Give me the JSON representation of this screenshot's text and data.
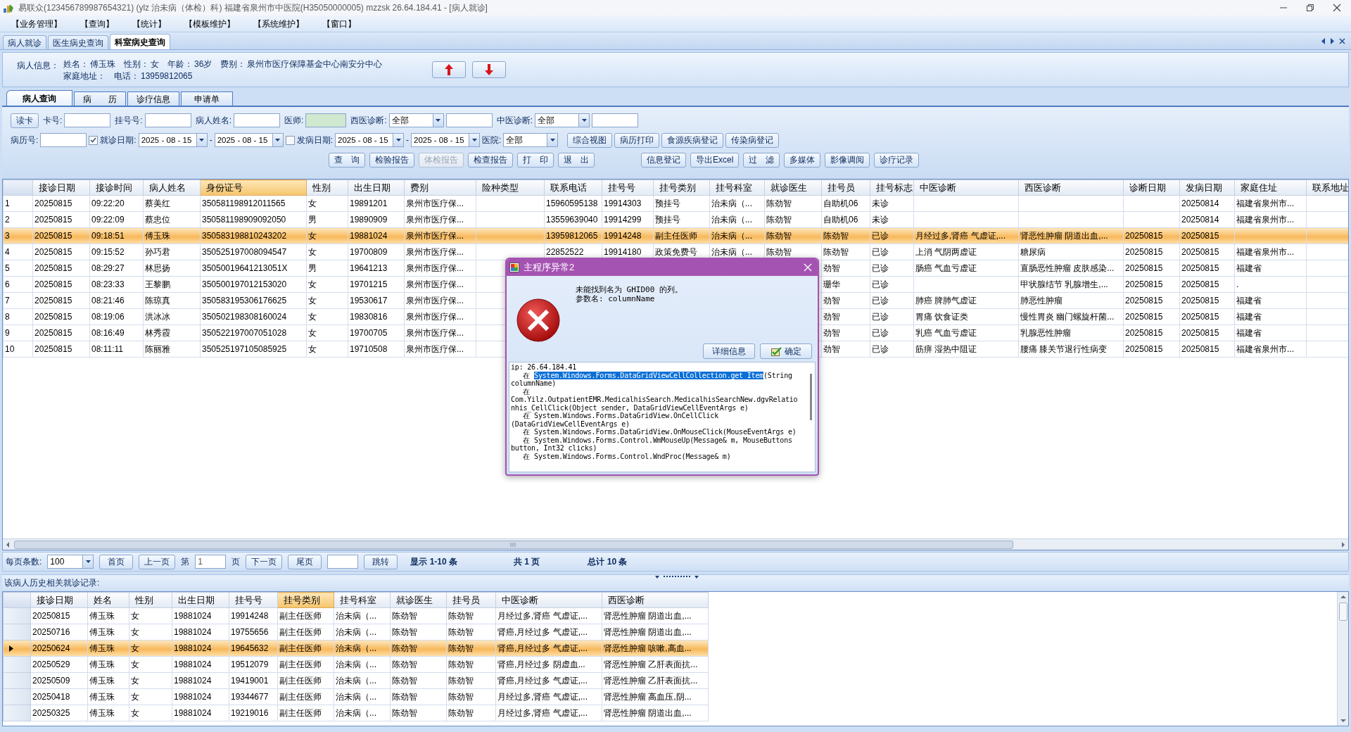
{
  "window": {
    "title": "易联众(123456789987654321) (ylz 治未病（体检）科) 福建省泉州市中医院(H35050000005) mzzsk 26.64.184.41 - [病人就诊]"
  },
  "menu": [
    "【业务管理】",
    "【查询】",
    "【统计】",
    "【模板维护】",
    "【系统维护】",
    "【窗口】"
  ],
  "doc_tabs": [
    {
      "label": "病人就诊",
      "selected": false
    },
    {
      "label": "医生病史查询",
      "selected": false
    },
    {
      "label": "科室病史查询",
      "selected": true
    }
  ],
  "patient_info": {
    "title": "病人信息：",
    "lines": [
      [
        {
          "label": "姓名：",
          "value": "傅玉珠"
        },
        {
          "label": "性别：",
          "value": "女"
        },
        {
          "label": "年龄：",
          "value": "36岁"
        },
        {
          "label": "费别：",
          "value": "泉州市医疗保障基金中心南安分中心"
        }
      ],
      [
        {
          "label": "家庭地址："
        },
        {
          "label": "电话：",
          "value": "13959812065"
        }
      ]
    ]
  },
  "sub_tabs": [
    {
      "label": "病人查询",
      "selected": true
    },
    {
      "label": "病　　历",
      "selected": false
    },
    {
      "label": "诊疗信息",
      "selected": false
    },
    {
      "label": "申请单",
      "selected": false
    }
  ],
  "filter": {
    "row_1": [
      {
        "kind": "button",
        "label": "读卡"
      },
      {
        "kind": "label",
        "text": "卡号:"
      },
      {
        "kind": "field",
        "required": false
      },
      {
        "kind": "label",
        "text": "挂号号:"
      },
      {
        "kind": "field",
        "required": false
      },
      {
        "kind": "label",
        "text": "病人姓名:"
      },
      {
        "kind": "field",
        "required": false
      },
      {
        "kind": "label",
        "text": "医师:"
      },
      {
        "kind": "field",
        "required": true
      },
      {
        "kind": "label",
        "text": "西医诊断:"
      },
      {
        "kind": "combo",
        "value": "全部"
      },
      {
        "kind": "field",
        "required": false
      },
      {
        "kind": "label",
        "text": "中医诊断:"
      },
      {
        "kind": "combo",
        "value": "全部"
      },
      {
        "kind": "field",
        "required": false
      }
    ],
    "row_2": [
      {
        "kind": "label",
        "text": "病历号:"
      },
      {
        "kind": "field",
        "required": false
      },
      {
        "kind": "checkbox",
        "checked": true
      },
      {
        "kind": "label",
        "text": "就诊日期:"
      },
      {
        "kind": "date",
        "value": "2025 - 08 - 15"
      },
      {
        "kind": "label",
        "text": "-"
      },
      {
        "kind": "date",
        "value": "2025 - 08 - 15"
      },
      {
        "kind": "checkbox",
        "checked": false
      },
      {
        "kind": "label",
        "text": "发病日期:"
      },
      {
        "kind": "date",
        "value": "2025 - 08 - 15"
      },
      {
        "kind": "label",
        "text": "-"
      },
      {
        "kind": "date",
        "value": "2025 - 08 - 15"
      },
      {
        "kind": "label",
        "text": "医院:"
      },
      {
        "kind": "combo",
        "value": "全部"
      },
      {
        "kind": "button",
        "label": "综合视图"
      },
      {
        "kind": "button",
        "label": "病历打印"
      },
      {
        "kind": "button",
        "label": "食源疾病登记"
      },
      {
        "kind": "button",
        "label": "传染病登记"
      }
    ],
    "row_3": {
      "left_buttons": [
        {
          "label": "查　询",
          "disabled": false
        },
        {
          "label": "检验报告",
          "disabled": false
        },
        {
          "label": "体检报告",
          "disabled": true
        },
        {
          "label": "检查报告",
          "disabled": false
        },
        {
          "label": "打　印",
          "disabled": false
        },
        {
          "label": "退　出",
          "disabled": false
        }
      ],
      "right_buttons": [
        {
          "label": "信息登记",
          "disabled": false
        },
        {
          "label": "导出Excel",
          "disabled": false
        },
        {
          "label": "过　滤",
          "disabled": false
        },
        {
          "label": "多媒体",
          "disabled": false
        },
        {
          "label": "影像调阅",
          "disabled": false
        },
        {
          "label": "诊疗记录",
          "disabled": false
        }
      ]
    }
  },
  "main_grid": {
    "columns": [
      {
        "label": "接诊日期",
        "selected": false
      },
      {
        "label": "接诊时间",
        "selected": false
      },
      {
        "label": "病人姓名",
        "selected": false
      },
      {
        "label": "身份证号",
        "selected": true
      },
      {
        "label": "性别",
        "selected": false
      },
      {
        "label": "出生日期",
        "selected": false
      },
      {
        "label": "费别",
        "selected": false
      },
      {
        "label": "险种类型",
        "selected": false
      },
      {
        "label": "联系电话",
        "selected": false
      },
      {
        "label": "挂号号",
        "selected": false
      },
      {
        "label": "挂号类别",
        "selected": false
      },
      {
        "label": "挂号科室",
        "selected": false
      },
      {
        "label": "就诊医生",
        "selected": false
      },
      {
        "label": "挂号员",
        "selected": false
      },
      {
        "label": "挂号标志",
        "selected": false
      },
      {
        "label": "中医诊断",
        "selected": false
      },
      {
        "label": "西医诊断",
        "selected": false
      },
      {
        "label": "诊断日期",
        "selected": false
      },
      {
        "label": "发病日期",
        "selected": false
      },
      {
        "label": "家庭住址",
        "selected": false
      },
      {
        "label": "联系地址",
        "selected": false
      }
    ],
    "rows": [
      {
        "number": "1",
        "selected": false,
        "cells": [
          "20250815",
          "09:22:20",
          "蔡美红",
          "350581198912011565",
          "女",
          "19891201",
          "泉州市医疗保...",
          null,
          "15960595138",
          "19914303",
          "预挂号",
          "治未病（...",
          "陈劲智",
          "自助机06",
          "未诊",
          null,
          null,
          null,
          "20250814",
          "福建省泉州市...",
          null
        ]
      },
      {
        "number": "2",
        "selected": false,
        "cells": [
          "20250815",
          "09:22:09",
          "蔡忠位",
          "350581198909092050",
          "男",
          "19890909",
          "泉州市医疗保...",
          null,
          "13559639040",
          "19914299",
          "预挂号",
          "治未病（...",
          "陈劲智",
          "自助机06",
          "未诊",
          null,
          null,
          null,
          "20250814",
          "福建省泉州市...",
          null
        ]
      },
      {
        "number": "3",
        "selected": true,
        "cells": [
          "20250815",
          "09:18:51",
          "傅玉珠",
          "350583198810243202",
          "女",
          "19881024",
          "泉州市医疗保...",
          null,
          "13959812065",
          "19914248",
          "副主任医师",
          "治未病（...",
          "陈劲智",
          "陈劲智",
          "已诊",
          "月经过多,肾癌 气虚证,...",
          "肾恶性肿瘤 阴道出血,...",
          "20250815",
          "20250815",
          null,
          null
        ]
      },
      {
        "number": "4",
        "selected": false,
        "cells": [
          "20250815",
          "09:15:52",
          "孙巧君",
          "350525197008094547",
          "女",
          "19700809",
          "泉州市医疗保...",
          null,
          "22852522",
          "19914180",
          "政策免费号",
          "治未病（...",
          "陈劲智",
          "陈劲智",
          "已诊",
          "上消 气阴两虚证",
          "糖尿病",
          "20250815",
          "20250815",
          "福建省泉州市...",
          null
        ]
      },
      {
        "number": "5",
        "selected": false,
        "cells": [
          "20250815",
          "08:29:27",
          "林思扬",
          "35050019641213051X",
          "男",
          "19641213",
          "泉州市医疗保...",
          null,
          null,
          null,
          null,
          null,
          null,
          "劲智",
          "已诊",
          "肠癌 气血亏虚证",
          "直肠恶性肿瘤 皮肤感染...",
          "20250815",
          "20250815",
          "福建省",
          null
        ]
      },
      {
        "number": "6",
        "selected": false,
        "cells": [
          "20250815",
          "08:23:33",
          "王黎鹏",
          "350500197012153020",
          "女",
          "19701215",
          "泉州市医疗保...",
          null,
          null,
          null,
          null,
          null,
          null,
          "珊华",
          "已诊",
          null,
          "甲状腺结节 乳腺增生,...",
          "20250815",
          "20250815",
          ".",
          null
        ]
      },
      {
        "number": "7",
        "selected": false,
        "cells": [
          "20250815",
          "08:21:46",
          "陈琼真",
          "350583195306176625",
          "女",
          "19530617",
          "泉州市医疗保...",
          null,
          null,
          null,
          null,
          null,
          null,
          "劲智",
          "已诊",
          "肺癌 脾肺气虚证",
          "肺恶性肿瘤",
          "20250815",
          "20250815",
          "福建省",
          null
        ]
      },
      {
        "number": "8",
        "selected": false,
        "cells": [
          "20250815",
          "08:19:06",
          "洪冰冰",
          "350502198308160024",
          "女",
          "19830816",
          "泉州市医疗保...",
          null,
          null,
          null,
          null,
          null,
          null,
          "劲智",
          "已诊",
          "胃痛 饮食证类",
          "慢性胃炎 幽门螺旋杆菌...",
          "20250815",
          "20250815",
          "福建省",
          null
        ]
      },
      {
        "number": "9",
        "selected": false,
        "cells": [
          "20250815",
          "08:16:49",
          "林秀霞",
          "350522197007051028",
          "女",
          "19700705",
          "泉州市医疗保...",
          null,
          null,
          null,
          null,
          null,
          null,
          "劲智",
          "已诊",
          "乳癌 气血亏虚证",
          "乳腺恶性肿瘤",
          "20250815",
          "20250815",
          "福建省",
          null
        ]
      },
      {
        "number": "10",
        "selected": false,
        "cells": [
          "20250815",
          "08:11:11",
          "陈丽雅",
          "350525197105085925",
          "女",
          "19710508",
          "泉州市医疗保...",
          null,
          null,
          null,
          null,
          null,
          null,
          "劲智",
          "已诊",
          "筋痹 湿热中阻证",
          "腰痛 膝关节退行性病变",
          "20250815",
          "20250815",
          "福建省泉州市...",
          null
        ]
      }
    ]
  },
  "pager": {
    "page_size_label": "每页条数:",
    "page_size": "100",
    "first": "首页",
    "prev": "上一页",
    "page_prefix": "第",
    "page": "1",
    "page_suffix": "页",
    "next": "下一页",
    "last": "尾页",
    "goto": "跳转",
    "showing": "显示 1-10 条",
    "pages": "共 1 页",
    "total": "总计 10 条"
  },
  "history_label": "该病人历史相关就诊记录:",
  "history_grid": {
    "columns": [
      {
        "label": "接诊日期",
        "selected": false
      },
      {
        "label": "姓名",
        "selected": false
      },
      {
        "label": "性别",
        "selected": false
      },
      {
        "label": "出生日期",
        "selected": false
      },
      {
        "label": "挂号号",
        "selected": false
      },
      {
        "label": "挂号类别",
        "selected": true
      },
      {
        "label": "挂号科室",
        "selected": false
      },
      {
        "label": "就诊医生",
        "selected": false
      },
      {
        "label": "挂号员",
        "selected": false
      },
      {
        "label": "中医诊断",
        "selected": false
      },
      {
        "label": "西医诊断",
        "selected": false
      }
    ],
    "rows": [
      {
        "selected": false,
        "cells": [
          "20250815",
          "傅玉珠",
          "女",
          "19881024",
          "19914248",
          "副主任医师",
          "治未病（...",
          "陈劲智",
          "陈劲智",
          "月经过多,肾癌 气虚证,...",
          "肾恶性肿瘤 阴道出血,..."
        ]
      },
      {
        "selected": false,
        "cells": [
          "20250716",
          "傅玉珠",
          "女",
          "19881024",
          "19755656",
          "副主任医师",
          "治未病（...",
          "陈劲智",
          "陈劲智",
          "肾癌,月经过多 气虚证,...",
          "肾恶性肿瘤 阴道出血,..."
        ]
      },
      {
        "selected": true,
        "cells": [
          "20250624",
          "傅玉珠",
          "女",
          "19881024",
          "19645632",
          "副主任医师",
          "治未病（...",
          "陈劲智",
          "陈劲智",
          "肾癌,月经过多 气虚证,...",
          "肾恶性肿瘤 咳嗽,高血..."
        ]
      },
      {
        "selected": false,
        "cells": [
          "20250529",
          "傅玉珠",
          "女",
          "19881024",
          "19512079",
          "副主任医师",
          "治未病（...",
          "陈劲智",
          "陈劲智",
          "肾癌,月经过多 阴虚血...",
          "肾恶性肿瘤 乙肝表面抗..."
        ]
      },
      {
        "selected": false,
        "cells": [
          "20250509",
          "傅玉珠",
          "女",
          "19881024",
          "19419001",
          "副主任医师",
          "治未病（...",
          "陈劲智",
          "陈劲智",
          "肾癌,月经过多 气虚证,...",
          "肾恶性肿瘤 乙肝表面抗..."
        ]
      },
      {
        "selected": false,
        "cells": [
          "20250418",
          "傅玉珠",
          "女",
          "19881024",
          "19344677",
          "副主任医师",
          "治未病（...",
          "陈劲智",
          "陈劲智",
          "月经过多,肾癌 气虚证,...",
          "肾恶性肿瘤 高血压,阴..."
        ]
      },
      {
        "selected": false,
        "cells": [
          "20250325",
          "傅玉珠",
          "女",
          "19881024",
          "19219016",
          "副主任医师",
          "治未病（...",
          "陈劲智",
          "陈劲智",
          "月经过多,肾癌 气虚证,...",
          "肾恶性肿瘤 阴道出血,..."
        ]
      }
    ]
  },
  "dialog": {
    "title": "主程序异常2",
    "message": "未能找到名为 GHID00 的列。",
    "param": "参数名: columnName",
    "buttons": [
      {
        "kind": "details",
        "label": "详细信息"
      },
      {
        "kind": "ok",
        "label": "确定"
      }
    ],
    "detail_lines": [
      [
        {
          "text": "ip: 26.64.184.41",
          "selected": false
        }
      ],
      [
        {
          "text": "   在 ",
          "selected": false
        },
        {
          "text": "System.Windows.Forms.DataGridViewCellCollection.get_Item",
          "selected": true
        },
        {
          "text": "(String",
          "selected": false
        }
      ],
      [
        {
          "text": "columnName)",
          "selected": false
        }
      ],
      [
        {
          "text": "   在",
          "selected": false
        }
      ],
      [
        {
          "text": "Com.Yilz.OutpatientEMR.MedicalhisSearch.MedicalhisSearchNew.dgvRelatio",
          "selected": false
        }
      ],
      [
        {
          "text": "nhis_CellClick(Object sender, DataGridViewCellEventArgs e)",
          "selected": false
        }
      ],
      [
        {
          "text": "   在 System.Windows.Forms.DataGridView.OnCellClick",
          "selected": false
        }
      ],
      [
        {
          "text": "(DataGridViewCellEventArgs e)",
          "selected": false
        }
      ],
      [
        {
          "text": "   在 System.Windows.Forms.DataGridView.OnMouseClick(MouseEventArgs e)",
          "selected": false
        }
      ],
      [
        {
          "text": "   在 System.Windows.Forms.Control.WmMouseUp(Message& m, MouseButtons",
          "selected": false
        }
      ],
      [
        {
          "text": "button, Int32 clicks)",
          "selected": false
        }
      ],
      [
        {
          "text": "   在 System.Windows.Forms.Control.WndProc(Message& m)",
          "selected": false
        }
      ]
    ]
  }
}
